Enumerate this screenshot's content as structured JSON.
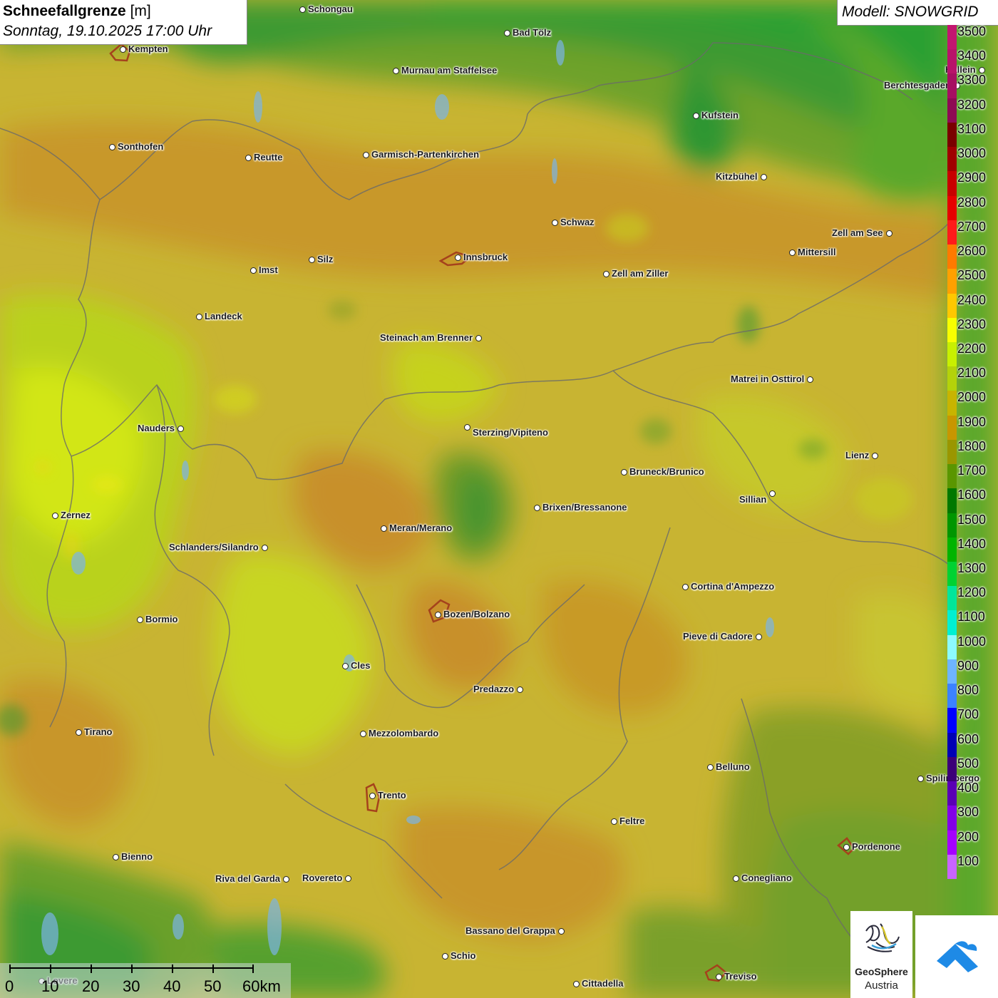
{
  "title": {
    "main": "Schneefallgrenze",
    "unit": "[m]",
    "datetime": "Sonntag, 19.10.2025 17:00 Uhr"
  },
  "model": {
    "label": "Modell: SNOWGRID"
  },
  "legend": {
    "steps": [
      {
        "label": "3500",
        "color": "#c21670"
      },
      {
        "label": "3400",
        "color": "#b8136a"
      },
      {
        "label": "3300",
        "color": "#a60f62"
      },
      {
        "label": "3200",
        "color": "#8e0a54"
      },
      {
        "label": "3100",
        "color": "#7a0000"
      },
      {
        "label": "3000",
        "color": "#a00000"
      },
      {
        "label": "2900",
        "color": "#c80000"
      },
      {
        "label": "2800",
        "color": "#e60000"
      },
      {
        "label": "2700",
        "color": "#ff1a1a"
      },
      {
        "label": "2600",
        "color": "#ff7a00"
      },
      {
        "label": "2500",
        "color": "#ffa000"
      },
      {
        "label": "2400",
        "color": "#ffc800"
      },
      {
        "label": "2300",
        "color": "#f8ff00"
      },
      {
        "label": "2200",
        "color": "#c8f000"
      },
      {
        "label": "2100",
        "color": "#b4d20a"
      },
      {
        "label": "2000",
        "color": "#c8b400"
      },
      {
        "label": "1900",
        "color": "#c89600"
      },
      {
        "label": "1800",
        "color": "#9a9600"
      },
      {
        "label": "1700",
        "color": "#5a9600"
      },
      {
        "label": "1600",
        "color": "#007800"
      },
      {
        "label": "1500",
        "color": "#009600"
      },
      {
        "label": "1400",
        "color": "#00b400"
      },
      {
        "label": "1300",
        "color": "#00d232"
      },
      {
        "label": "1200",
        "color": "#00e69b"
      },
      {
        "label": "1100",
        "color": "#00f0d2"
      },
      {
        "label": "1000",
        "color": "#8cfaff"
      },
      {
        "label": "900",
        "color": "#6eb4ff"
      },
      {
        "label": "800",
        "color": "#3c82ff"
      },
      {
        "label": "700",
        "color": "#0000ff"
      },
      {
        "label": "600",
        "color": "#0000b4"
      },
      {
        "label": "500",
        "color": "#3c0078"
      },
      {
        "label": "400",
        "color": "#5a00b4"
      },
      {
        "label": "300",
        "color": "#8200e6"
      },
      {
        "label": "200",
        "color": "#a500ff"
      },
      {
        "label": "100",
        "color": "#c864ff"
      }
    ]
  },
  "cities": [
    {
      "name": "Schongau"
    },
    {
      "name": "Bad Tölz"
    },
    {
      "name": "Kempten"
    },
    {
      "name": "Murnau am Staffelsee"
    },
    {
      "name": "Hallein"
    },
    {
      "name": "Berchtesgaden"
    },
    {
      "name": "Kufstein"
    },
    {
      "name": "Sonthofen"
    },
    {
      "name": "Reutte"
    },
    {
      "name": "Garmisch-Partenkirchen"
    },
    {
      "name": "Kitzbühel"
    },
    {
      "name": "Schwaz"
    },
    {
      "name": "Zell am See"
    },
    {
      "name": "Innsbruck"
    },
    {
      "name": "Mittersill"
    },
    {
      "name": "Silz"
    },
    {
      "name": "Imst"
    },
    {
      "name": "Zell am Ziller"
    },
    {
      "name": "Landeck"
    },
    {
      "name": "Steinach am Brenner"
    },
    {
      "name": "Matrei in Osttirol"
    },
    {
      "name": "Nauders"
    },
    {
      "name": "Sterzing/Vipiteno"
    },
    {
      "name": "Lienz"
    },
    {
      "name": "Bruneck/Brunico"
    },
    {
      "name": "Sillian"
    },
    {
      "name": "Brixen/Bressanone"
    },
    {
      "name": "Zernez"
    },
    {
      "name": "Meran/Merano"
    },
    {
      "name": "Schlanders/Silandro"
    },
    {
      "name": "Cortina d'Ampezzo"
    },
    {
      "name": "Bozen/Bolzano"
    },
    {
      "name": "Bormio"
    },
    {
      "name": "Pieve di Cadore"
    },
    {
      "name": "Cles"
    },
    {
      "name": "Predazzo"
    },
    {
      "name": "Tirano"
    },
    {
      "name": "Mezzolombardo"
    },
    {
      "name": "Belluno"
    },
    {
      "name": "Spilimbergo"
    },
    {
      "name": "Trento"
    },
    {
      "name": "Feltre"
    },
    {
      "name": "Pordenone"
    },
    {
      "name": "Bienno"
    },
    {
      "name": "Riva del Garda"
    },
    {
      "name": "Rovereto"
    },
    {
      "name": "Conegliano"
    },
    {
      "name": "Bassano del Grappa"
    },
    {
      "name": "Schio"
    },
    {
      "name": "Treviso"
    },
    {
      "name": "Cittadella"
    },
    {
      "name": "Lovere"
    }
  ],
  "scalebar": {
    "ticks": [
      "0",
      "10",
      "20",
      "30",
      "40",
      "50"
    ],
    "last": "60km"
  },
  "logo": {
    "name": "GeoSphere",
    "sub": "Austria"
  }
}
